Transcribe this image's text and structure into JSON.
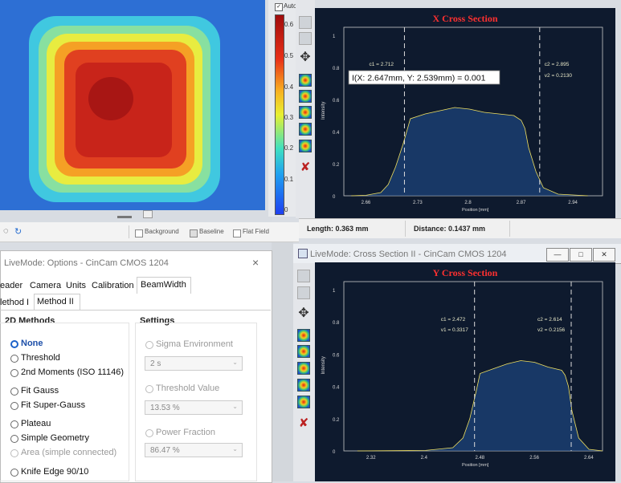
{
  "colorbar": {
    "auto_label": "Auto",
    "ticks": [
      "0.6",
      "0.5",
      "0.4",
      "0.3",
      "0.2",
      "0.1",
      "0"
    ]
  },
  "x_plot": {
    "title": "X Cross Section",
    "xlabel": "Position [mm]",
    "ylabel": "Intensity",
    "x_ticks": [
      "2.66",
      "2.73",
      "2.8",
      "2.87",
      "2.94"
    ],
    "y_ticks": [
      "1",
      "0.8",
      "0.6",
      "0.4",
      "0.2",
      "0"
    ],
    "c1_label": "c1 = 2.712",
    "c2_label": "c2 = 2.895",
    "v2_label": "v2 = 0.2130",
    "tooltip": "I(X: 2.647mm, Y: 2.539mm) = 0.001"
  },
  "x_status": {
    "length": "Length: 0.363 mm",
    "distance": "Distance: 0.1437 mm"
  },
  "options_strip": {
    "background": "Background",
    "baseline": "Baseline",
    "flat_field": "Flat Field"
  },
  "dialog": {
    "title": "LiveMode: Options - CinCam CMOS 1204",
    "close": "×",
    "tabs_row1": [
      "eader",
      "Camera",
      "Units",
      "Calibration",
      "BeamWidth"
    ],
    "tabs_row2": [
      "lethod I",
      "Method II"
    ],
    "methods_title": "2D Methods",
    "methods": [
      {
        "label": "None",
        "selected": true,
        "disabled": false
      },
      {
        "label": "Threshold",
        "selected": false,
        "disabled": false
      },
      {
        "label": "2nd Moments (ISO 11146)",
        "selected": false,
        "disabled": false
      },
      {
        "label": "Fit Gauss",
        "selected": false,
        "disabled": false
      },
      {
        "label": "Fit Super-Gauss",
        "selected": false,
        "disabled": false
      },
      {
        "label": "Plateau",
        "selected": false,
        "disabled": false
      },
      {
        "label": "Simple Geometry",
        "selected": false,
        "disabled": false
      },
      {
        "label": "Area (simple connected)",
        "selected": false,
        "disabled": true
      },
      {
        "label": "Knife Edge 90/10",
        "selected": false,
        "disabled": false
      }
    ],
    "settings_title": "Settings",
    "sigma_label": "Sigma Environment",
    "sigma_value": "2 s",
    "threshold_label": "Threshold Value",
    "threshold_value": "13.53 %",
    "power_label": "Power Fraction",
    "power_value": "86.47 %"
  },
  "y_window": {
    "title": "LiveMode: Cross Section II - CinCam CMOS 1204",
    "minimize": "—",
    "restore": "□",
    "close": "✕"
  },
  "y_plot": {
    "title": "Y Cross Section",
    "xlabel": "Position [mm]",
    "ylabel": "Intensity",
    "x_ticks": [
      "2.32",
      "2.4",
      "2.48",
      "2.56",
      "2.64"
    ],
    "y_ticks": [
      "1",
      "0.8",
      "0.6",
      "0.4",
      "0.2",
      "0"
    ],
    "c1_label": "c1 = 2.472",
    "v1_label": "v1 = 0.3317",
    "c2_label": "c2 = 2.614",
    "v2_label": "v2 = 0.2156"
  },
  "chart_data": [
    {
      "type": "line",
      "title": "X Cross Section",
      "xlabel": "Position [mm]",
      "ylabel": "Intensity",
      "xlim": [
        2.63,
        2.98
      ],
      "ylim": [
        0,
        1.05
      ],
      "cursors": {
        "c1": 2.712,
        "c2": 2.895
      },
      "x": [
        2.64,
        2.66,
        2.68,
        2.69,
        2.7,
        2.71,
        2.72,
        2.74,
        2.76,
        2.78,
        2.8,
        2.82,
        2.84,
        2.86,
        2.87,
        2.875,
        2.88,
        2.89,
        2.9,
        2.92,
        2.96
      ],
      "y": [
        0.0,
        0.003,
        0.02,
        0.07,
        0.18,
        0.32,
        0.48,
        0.51,
        0.53,
        0.55,
        0.54,
        0.52,
        0.51,
        0.5,
        0.47,
        0.42,
        0.3,
        0.15,
        0.05,
        0.01,
        0.0
      ]
    },
    {
      "type": "line",
      "title": "Y Cross Section",
      "xlabel": "Position [mm]",
      "ylabel": "Intensity",
      "xlim": [
        2.28,
        2.66
      ],
      "ylim": [
        0,
        1.05
      ],
      "cursors": {
        "c1": 2.472,
        "c2": 2.614
      },
      "x": [
        2.3,
        2.4,
        2.44,
        2.455,
        2.465,
        2.475,
        2.48,
        2.5,
        2.52,
        2.54,
        2.56,
        2.58,
        2.6,
        2.605,
        2.61,
        2.615,
        2.625,
        2.64,
        2.66
      ],
      "y": [
        0.0,
        0.003,
        0.02,
        0.08,
        0.2,
        0.38,
        0.48,
        0.51,
        0.54,
        0.56,
        0.55,
        0.52,
        0.5,
        0.47,
        0.4,
        0.25,
        0.08,
        0.01,
        0.0
      ]
    }
  ]
}
